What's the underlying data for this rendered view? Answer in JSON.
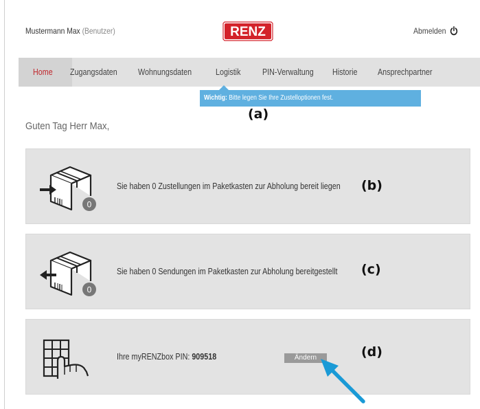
{
  "header": {
    "user_name": "Mustermann Max",
    "user_role": "(Benutzer)",
    "brand": "RENZ",
    "logout_label": "Abmelden"
  },
  "nav": {
    "items": [
      {
        "label": "Home",
        "active": true
      },
      {
        "label": "Zugangsdaten",
        "active": false
      },
      {
        "label": "Wohnungsdaten",
        "active": false
      },
      {
        "label": "Logistik",
        "active": false
      },
      {
        "label": "PIN-Verwaltung",
        "active": false
      },
      {
        "label": "Historie",
        "active": false
      },
      {
        "label": "Ansprechpartner",
        "active": false
      }
    ]
  },
  "notice": {
    "bold": "Wichtig:",
    "text": " Bitte legen Sie Ihre Zustelloptionen fest."
  },
  "annotations": {
    "a": "(a)",
    "b": "(b)",
    "c": "(c)",
    "d": "(d)"
  },
  "greeting": "Guten Tag Herr Max,",
  "panels": {
    "deliveries": {
      "text": "Sie haben 0 Zustellungen im Paketkasten zur Abholung bereit liegen",
      "count": "0",
      "icon": "package-incoming-icon"
    },
    "shipments": {
      "text": "Sie haben 0 Sendungen im Paketkasten zur Abholung bereitgestellt",
      "count": "0",
      "icon": "package-outgoing-icon"
    },
    "pin": {
      "label": "Ihre myRENZbox PIN: ",
      "value": "909518",
      "button": "Ändern",
      "icon": "keypad-hand-icon"
    }
  },
  "colors": {
    "brand_red": "#d3222a",
    "active_nav": "#c0282e",
    "notice_blue": "#5fb0e0",
    "arrow_blue": "#1a9ad6",
    "panel_gray": "#e3e3e3"
  }
}
